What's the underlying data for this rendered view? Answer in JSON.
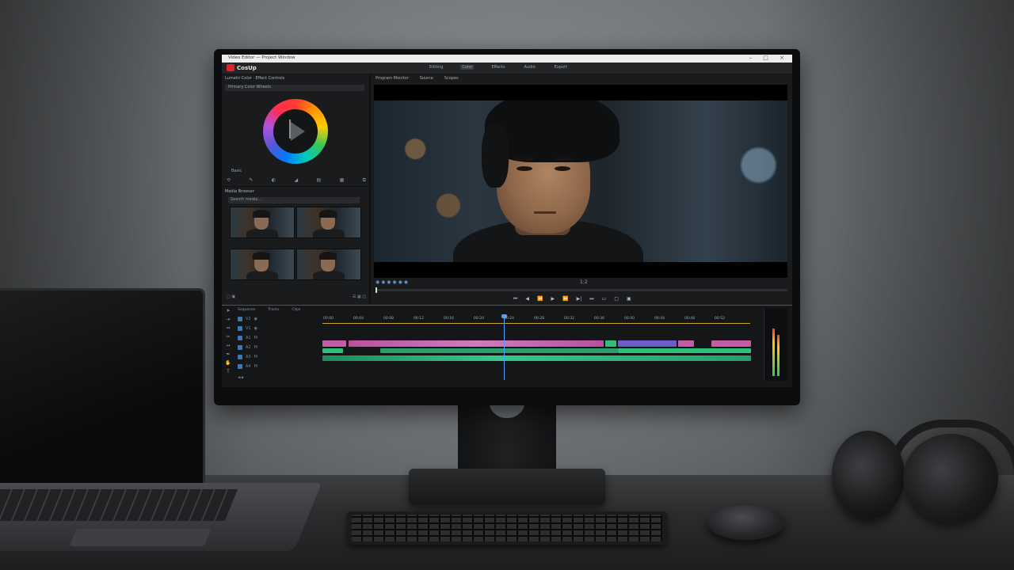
{
  "app": {
    "title_bar_text": "Video Editor — Project Window",
    "logo_text": "CosUp",
    "window_controls": "– □ ×"
  },
  "menu": {
    "items": [
      "Editing",
      "Color",
      "Effects",
      "Audio",
      "Export"
    ]
  },
  "left_panel": {
    "header": "Lumetri Color · Effect Controls",
    "sub": "Primary Color Wheels",
    "wheel_label": "Basic",
    "tools": [
      "⟲",
      "✎",
      "◐",
      "◢",
      "▤",
      "▦",
      "⧉"
    ]
  },
  "media_browser": {
    "title": "Media Browser",
    "search": "Search media…",
    "footer_left": "▢ ▣",
    "footer_right": "☰ ▦ ◫"
  },
  "viewer": {
    "tabs": [
      "Program Monitor",
      "Source",
      "Scopes"
    ],
    "timecode": "1:2",
    "controls_left": "◉ ◉ ◉ ◉ ◉ ◉",
    "transport": [
      "⏮",
      "◀",
      "⏪",
      "▶",
      "⏩",
      "▶|",
      "⏭",
      "▭",
      "▢",
      "▣"
    ]
  },
  "timeline": {
    "tabs": [
      "Sequence",
      "Tracks",
      "Clips"
    ],
    "ruler": [
      "00:00",
      "00:04",
      "00:08",
      "00:12",
      "00:16",
      "00:20",
      "00:24",
      "00:28",
      "00:32",
      "00:36",
      "00:40",
      "00:44",
      "00:48",
      "00:52"
    ],
    "tracks": [
      "V2",
      "V1",
      "A1",
      "A2",
      "A3",
      "A4"
    ],
    "footer": "◀ ▶"
  },
  "colors": {
    "accent_blue": "#4da3ff",
    "clip_pink": "#c45ca8",
    "clip_purple": "#6b5cc8",
    "clip_green": "#2fbf7a"
  }
}
